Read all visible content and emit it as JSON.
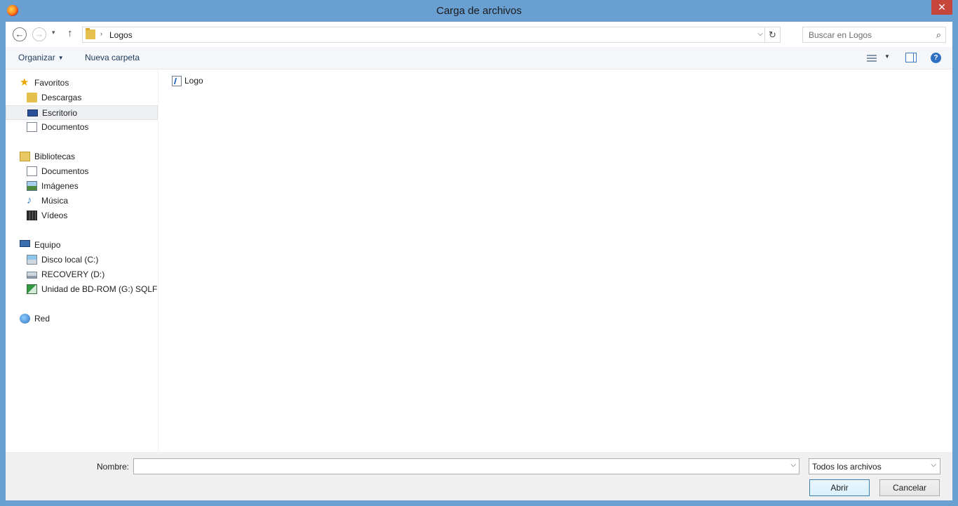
{
  "window": {
    "title": "Carga de archivos",
    "close_glyph": "✕",
    "app_icon": "firefox-icon"
  },
  "address_bar": {
    "back_glyph": "←",
    "forward_glyph": "→",
    "recent_glyph": "▾",
    "up_glyph": "↑",
    "separator_glyph": "›",
    "path": "Logos",
    "dropdown_glyph": "⌵",
    "refresh_glyph": "↻"
  },
  "search": {
    "placeholder": "Buscar en Logos",
    "icon_glyph": "⌕"
  },
  "toolbar": {
    "organize_label": "Organizar",
    "organize_caret": "▼",
    "new_folder_label": "Nueva carpeta",
    "view_caret": "▼",
    "help_glyph": "?"
  },
  "navigation": {
    "favorites": {
      "label": "Favoritos",
      "star_glyph": "★",
      "items": [
        {
          "label": "Descargas"
        },
        {
          "label": "Escritorio"
        },
        {
          "label": "Documentos"
        }
      ]
    },
    "libraries": {
      "label": "Bibliotecas",
      "items": [
        {
          "label": "Documentos"
        },
        {
          "label": "Imágenes"
        },
        {
          "label": "Música",
          "glyph": "♪"
        },
        {
          "label": "Vídeos"
        }
      ]
    },
    "computer": {
      "label": "Equipo",
      "items": [
        {
          "label": "Disco local (C:)"
        },
        {
          "label": "RECOVERY (D:)"
        },
        {
          "label": "Unidad de BD-ROM (G:) SQLFUI"
        }
      ]
    },
    "network": {
      "label": "Red"
    }
  },
  "files": [
    {
      "name": "Logo"
    }
  ],
  "bottom": {
    "name_label": "Nombre:",
    "name_value": "",
    "name_dropdown_glyph": "⌵",
    "filter_value": "Todos los archivos",
    "filter_dropdown_glyph": "⌵",
    "open_label": "Abrir",
    "cancel_label": "Cancelar"
  }
}
